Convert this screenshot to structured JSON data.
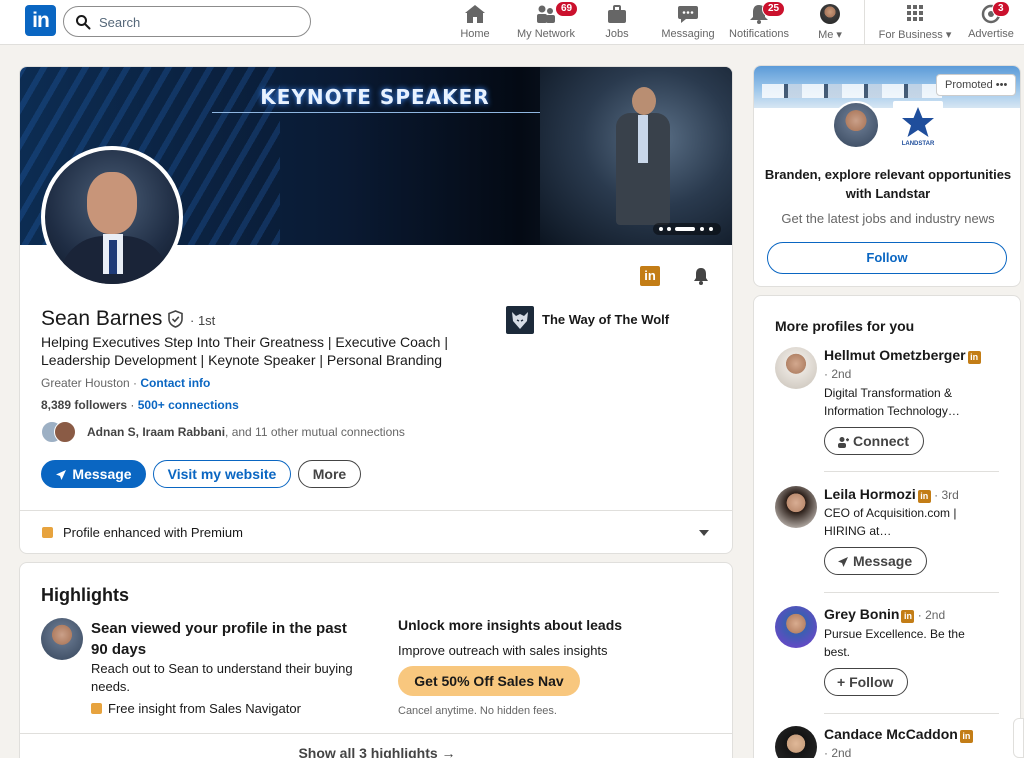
{
  "nav": {
    "logo": "in",
    "search_placeholder": "Search",
    "items": [
      {
        "label": "Home"
      },
      {
        "label": "My Network",
        "badge": "69"
      },
      {
        "label": "Jobs"
      },
      {
        "label": "Messaging"
      },
      {
        "label": "Notifications",
        "badge": "25"
      },
      {
        "label": "Me ▾"
      },
      {
        "label": "For Business ▾"
      },
      {
        "label": "Advertise",
        "badge": "3"
      }
    ]
  },
  "profile": {
    "banner_title": "KEYNOTE SPEAKER",
    "name": "Sean Barnes",
    "degree": "· 1st",
    "headline": "Helping Executives Step Into Their Greatness | Executive Coach | Leadership Development | Keynote Speaker | Personal Branding",
    "location": "Greater Houston ·",
    "contact_info": "Contact info",
    "followers": "8,389 followers",
    "followers_sep": " · ",
    "connections": "500+ connections",
    "mutual_names": "Adnan S, Iraam Rabbani",
    "mutual_rest": ", and 11 other mutual connections",
    "company": "The Way of The Wolf",
    "buttons": {
      "message": "Message",
      "website": "Visit my website",
      "more": "More"
    },
    "premium_text": "Profile enhanced with Premium"
  },
  "highlights": {
    "title": "Highlights",
    "viewed_head": "Sean viewed your profile in the past 90 days",
    "viewed_sub": "Reach out to Sean to understand their buying needs.",
    "free_insight": "Free insight from Sales Navigator",
    "insights_head": "Unlock more insights about leads",
    "insights_sub": "Improve outreach with sales insights",
    "offer_button": "Get 50% Off Sales Nav",
    "note": "Cancel anytime. No hidden fees.",
    "show_all": "Show all 3 highlights →"
  },
  "ad": {
    "promoted": "Promoted •••",
    "brand_label": "LANDSTAR",
    "headline": "Branden, explore relevant opportunities with Landstar",
    "sub": "Get the latest jobs and industry news",
    "follow": "Follow"
  },
  "more_profiles": {
    "title": "More profiles for you",
    "people": [
      {
        "name": "Hellmut Ometzberger",
        "degree_line": "· 2nd",
        "desc": "Digital Transformation & Information Technology…",
        "action": "Connect"
      },
      {
        "name": "Leila Hormozi",
        "degree": " · 3rd",
        "desc": "CEO of Acquisition.com | HIRING at…",
        "action": "Message"
      },
      {
        "name": "Grey Bonin",
        "degree": " · 2nd",
        "desc": "Pursue Excellence. Be the best.",
        "action": "+ Follow"
      },
      {
        "name": "Candace McCaddon",
        "degree_line": "· 2nd"
      }
    ]
  },
  "colors": {
    "brand_blue": "#0a66c2",
    "badge_red": "#cb112d",
    "premium_gold": "#e7a33e",
    "offer_gold": "#f8c77e"
  }
}
